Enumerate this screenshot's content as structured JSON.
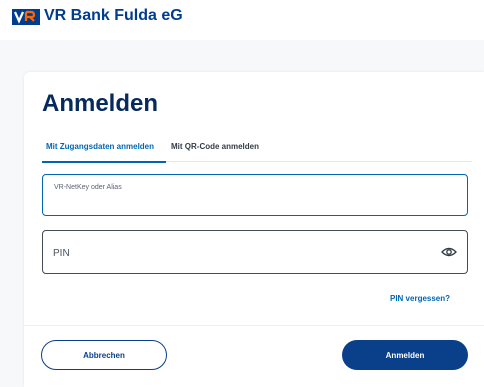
{
  "header": {
    "bank_name": "VR Bank Fulda eG",
    "logo_icon": "vr-bank-logo-icon"
  },
  "login": {
    "title": "Anmelden",
    "tabs": [
      {
        "label": "Mit Zugangsdaten anmelden",
        "active": true
      },
      {
        "label": "Mit QR-Code anmelden",
        "active": false
      }
    ],
    "username_field": {
      "label": "VR-NetKey oder Alias",
      "value": ""
    },
    "pin_field": {
      "placeholder": "PIN",
      "value": "",
      "icon": "eye-icon"
    },
    "forgot_pin_link": "PIN vergessen?",
    "cancel_button": "Abbrechen",
    "submit_button": "Anmelden"
  },
  "colors": {
    "brand_blue": "#003d8f",
    "accent_blue": "#0066b3",
    "logo_orange": "#ff6600"
  }
}
